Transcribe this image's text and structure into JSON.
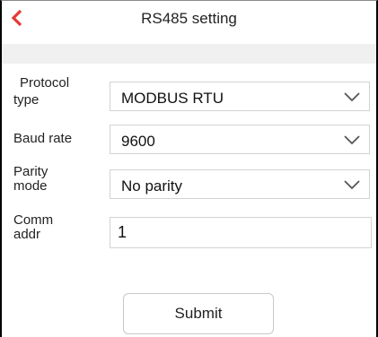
{
  "header": {
    "title": "RS485 setting",
    "back_icon": "chevron-left-icon",
    "accent_color": "#e53935"
  },
  "form": {
    "protocol": {
      "label_line1": "Protocol",
      "label_line2": "type",
      "value": "MODBUS RTU",
      "icon": "chevron-down-icon"
    },
    "baud": {
      "label": "Baud rate",
      "value": "9600",
      "icon": "chevron-down-icon"
    },
    "parity": {
      "label_line1": "Parity",
      "label_line2": "mode",
      "value": "No parity",
      "icon": "chevron-down-icon"
    },
    "comm_addr": {
      "label_line1": "Comm",
      "label_line2": "addr",
      "value": "1"
    }
  },
  "submit_label": "Submit"
}
